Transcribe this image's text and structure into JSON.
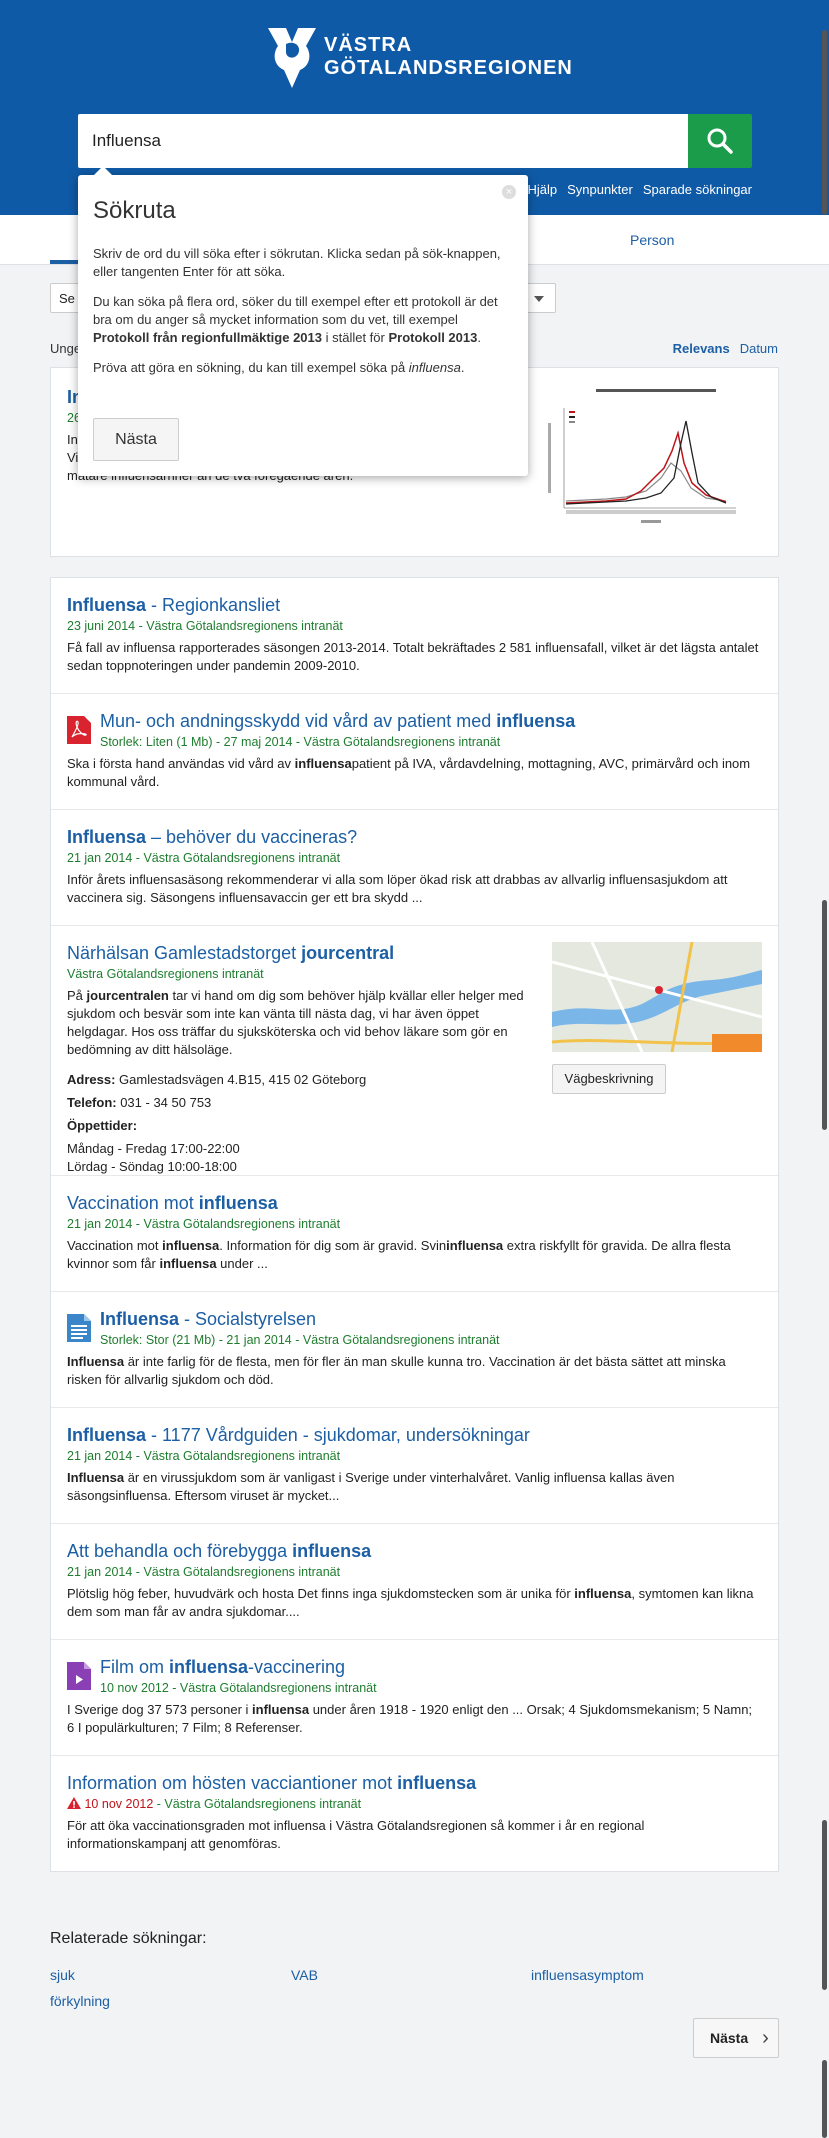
{
  "header": {
    "logo_line1": "VÄSTRA",
    "logo_line2": "GÖTALANDSREGIONEN",
    "search_value": "Influensa",
    "links": [
      "Hjälp",
      "Synpunkter",
      "Sparade sökningar"
    ]
  },
  "tabs": {
    "person": "Person"
  },
  "filter": {
    "label": "Se"
  },
  "results_count_prefix": "Unge",
  "sort": {
    "relevance": "Relevans",
    "date": "Datum"
  },
  "popover": {
    "title": "Sökruta",
    "p1": "Skriv de ord du vill söka efter i sökrutan. Klicka sedan på sök-knappen, eller tangenten Enter för att söka.",
    "p2_a": "Du kan söka på flera ord, söker du till exempel efter ett protokoll är det bra om du anger så mycket information som du vet, till exempel ",
    "p2_b": "Protokoll från regionfullmäktige 2013",
    "p2_c": " i stället för ",
    "p2_d": "Protokoll 2013",
    "p2_e": ".",
    "p3_a": "Pröva att göra en sökning, du kan till exempel söka på ",
    "p3_b": "influensa",
    "p3_c": ".",
    "next": "Nästa"
  },
  "featured": {
    "title_frag": "In",
    "meta_frag": "26",
    "desc_frag1": "In",
    "desc_frag2": "Vi",
    "desc_frag3": "mätare influensarnner än de två föregående åren."
  },
  "results": [
    {
      "t_hl": "Influensa",
      "t_rest": " - Regionkansliet",
      "meta": "23 juni 2014 - Västra Götalandsregionens intranät",
      "desc": "Få fall av influensa rapporterades säsongen 2013-2014. Totalt bekräftades 2 581 influensafall, vilket är det lägsta antalet sedan toppnoteringen under pandemin 2009-2010."
    },
    {
      "t_rest": "Mun- och andningsskydd vid vård av patient med ",
      "t_hl": "influensa",
      "meta": "Storlek: Liten (1 Mb) - 27 maj 2014 - Västra Götalandsregionens intranät",
      "d_a": "Ska i första hand användas vid vård av ",
      "d_b": "influensa",
      "d_c": "patient på IVA, vårdavdelning, mottagning, AVC, primärvård och inom kommunal vård."
    },
    {
      "t_hl": "Influensa",
      "t_rest": " – behöver du vaccineras?",
      "meta": "21 jan 2014 - Västra Götalandsregionens intranät",
      "desc": "Inför årets influensasäsong rekommenderar vi alla som löper ökad risk att drabbas av allvarlig influensasjukdom att vaccinera sig. Säsongens influensavaccin ger ett bra skydd ..."
    },
    {
      "t_rest": "Närhälsan Gamlestadstorget ",
      "t_hl": "jourcentral",
      "meta": "Västra Götalandsregionens intranät",
      "d_a": "På ",
      "d_b": "jourcentralen",
      "d_c": " tar vi hand om dig som behöver hjälp kvällar eller helger med sjukdom och besvär som inte kan vänta till nästa dag, vi har även öppet helgdagar. Hos oss träffar du sjuksköterska och vid behov läkare som gör en bedömning av ditt hälsoläge.",
      "address_label": "Adress:",
      "address": " Gamlestadsvägen 4.B15, 415 02 Göteborg",
      "phone_label": "Telefon:",
      "phone": " 031 - 34 50 753",
      "hours_label": "Öppettider:",
      "hours1": "Måndag - Fredag 17:00-22:00",
      "hours2": "Lördag - Söndag 10:00-18:00",
      "route": "Vägbeskrivning"
    },
    {
      "t_rest": "Vaccination mot ",
      "t_hl": "influensa",
      "meta": "21 jan 2014 - Västra Götalandsregionens intranät",
      "d_a": "Vaccination mot ",
      "d_b": "influensa",
      "d_c": ". Information för dig som är gravid. Svin",
      "d_d": "influensa",
      "d_e": " extra riskfyllt för gravida. De allra flesta kvinnor som får ",
      "d_f": "influensa",
      "d_g": " under ..."
    },
    {
      "t_hl": "Influensa",
      "t_rest": " - Socialstyrelsen",
      "meta": "Storlek: Stor (21 Mb) - 21 jan 2014 - Västra Götalandsregionens intranät",
      "d_a": "Influensa",
      "d_b": " är inte farlig för de flesta, men för fler än man skulle kunna tro. Vaccination är det bästa sättet att minska risken för allvarlig sjukdom och död."
    },
    {
      "t_hl": "Influensa",
      "t_rest": " - 1177 Vårdguiden - sjukdomar, undersökningar",
      "meta": "21 jan 2014 - Västra Götalandsregionens intranät",
      "d_a": "Influensa",
      "d_b": " är en virussjukdom som är vanligast i Sverige under vinterhalvåret. Vanlig influensa kallas även säsongsinfluensa. Eftersom viruset är mycket..."
    },
    {
      "t_rest": "Att behandla och förebygga ",
      "t_hl": "influensa",
      "meta": "21 jan 2014 - Västra Götalandsregionens intranät",
      "d_a": "Plötslig hög feber, huvudvärk och hosta Det finns inga sjukdomstecken som är unika för ",
      "d_b": "influensa",
      "d_c": ", symtomen kan likna dem som man får av andra sjukdomar...."
    },
    {
      "t_a": "Film om ",
      "t_hl": "influensa",
      "t_rest": "-vaccinering",
      "meta": "10 nov 2012 - Västra Götalandsregionens intranät",
      "d_a": "I Sverige dog 37 573 personer i ",
      "d_b": "influensa",
      "d_c": " under åren 1918 - 1920 enligt den ... Orsak; 4 Sjukdomsmekanism; 5 Namn; 6 I populärkulturen; 7 Film; 8 Referenser."
    },
    {
      "t_rest": "Information om hösten vacciantioner mot ",
      "t_hl": "influensa",
      "meta_warn": "10 nov 2012",
      "meta_rest": " - Västra Götalandsregionens intranät",
      "desc": "För att öka vaccinationsgraden mot influensa i Västra Götalandsregionen så kommer i år en regional informationskampanj att genomföras."
    }
  ],
  "related": {
    "title": "Relaterade sökningar:",
    "items": [
      "sjuk",
      "VAB",
      "influensasymptom",
      "förkylning"
    ]
  },
  "pagination": {
    "next": "Nästa"
  }
}
